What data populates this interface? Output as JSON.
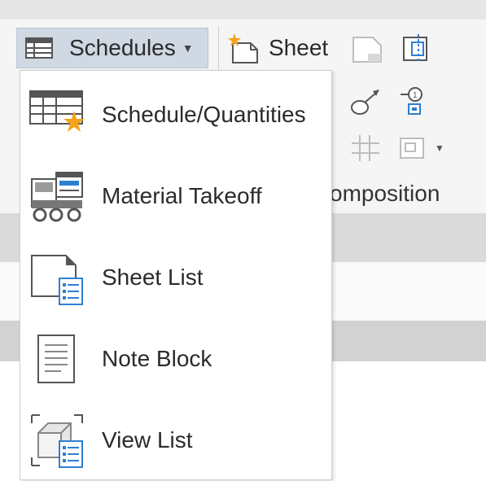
{
  "ribbon": {
    "schedules_button": {
      "label": "Schedules",
      "icon": "table-grid-icon"
    },
    "sheet_button": {
      "label": "Sheet",
      "icon": "new-sheet-icon"
    },
    "panel_label_partial": "omposition"
  },
  "menu": {
    "items": [
      {
        "label": "Schedule/Quantities",
        "icon": "schedule-quantities-icon"
      },
      {
        "label": "Material Takeoff",
        "icon": "material-takeoff-icon"
      },
      {
        "label": "Sheet List",
        "icon": "sheet-list-icon"
      },
      {
        "label": "Note Block",
        "icon": "note-block-icon"
      },
      {
        "label": "View List",
        "icon": "view-list-icon"
      }
    ]
  },
  "colors": {
    "button_highlight": "#cfd8e3",
    "accent_blue": "#2f7fd1",
    "accent_orange": "#f6a21a"
  }
}
